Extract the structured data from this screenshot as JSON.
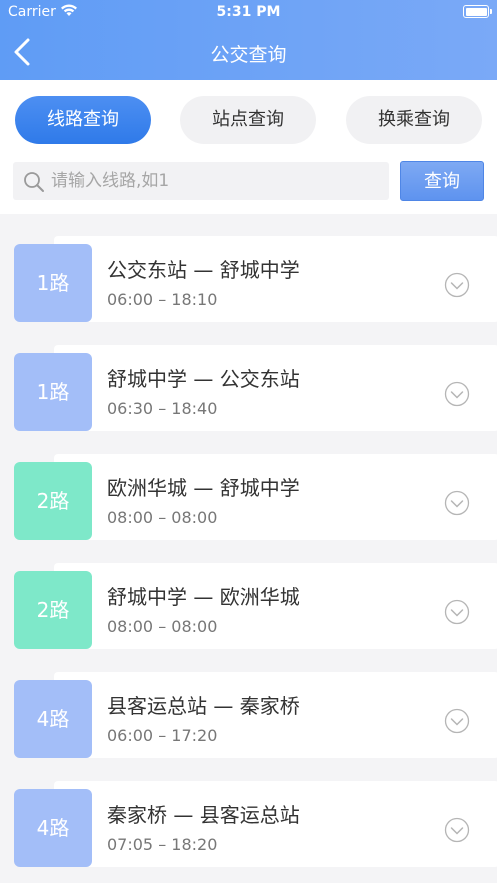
{
  "status_bar": {
    "carrier": "Carrier",
    "time": "5:31 PM"
  },
  "header": {
    "title": "公交查询"
  },
  "tabs": [
    {
      "label": "线路查询",
      "active": true
    },
    {
      "label": "站点查询",
      "active": false
    },
    {
      "label": "换乘查询",
      "active": false
    }
  ],
  "search": {
    "placeholder": "请输入线路,如1",
    "value": "",
    "button_label": "查询"
  },
  "colors": {
    "blue_badge": "#a3bef8",
    "green_badge": "#7ee8c9",
    "accent": "#3b80ee"
  },
  "routes": [
    {
      "line": "1路",
      "name": "公交东站 — 舒城中学",
      "hours": "06:00 – 18:10",
      "badge_color": "blue"
    },
    {
      "line": "1路",
      "name": "舒城中学 — 公交东站",
      "hours": "06:30 – 18:40",
      "badge_color": "blue"
    },
    {
      "line": "2路",
      "name": "欧洲华城 — 舒城中学",
      "hours": "08:00 – 08:00",
      "badge_color": "green"
    },
    {
      "line": "2路",
      "name": "舒城中学 — 欧洲华城",
      "hours": "08:00 – 08:00",
      "badge_color": "green"
    },
    {
      "line": "4路",
      "name": "县客运总站 — 秦家桥",
      "hours": "06:00 – 17:20",
      "badge_color": "blue"
    },
    {
      "line": "4路",
      "name": "秦家桥 — 县客运总站",
      "hours": "07:05 – 18:20",
      "badge_color": "blue"
    }
  ]
}
